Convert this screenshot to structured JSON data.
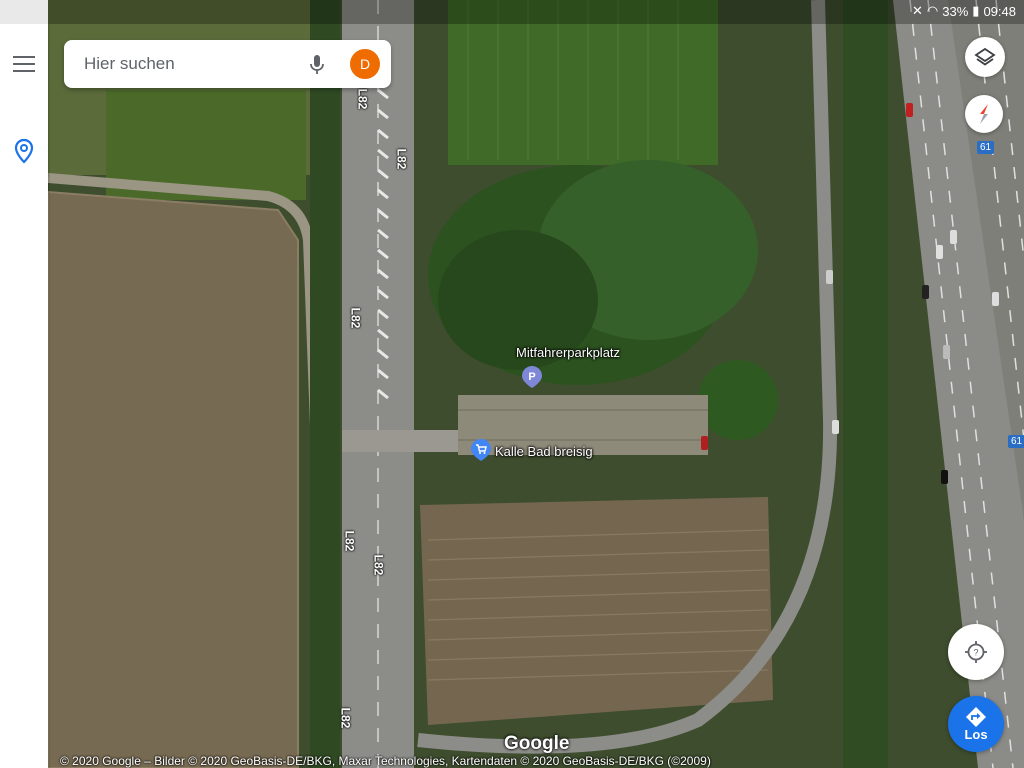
{
  "status_bar": {
    "battery": "33%",
    "time": "09:48"
  },
  "search": {
    "placeholder": "Hier suchen",
    "avatar_letter": "D"
  },
  "map": {
    "road_labels": [
      "L82",
      "L82",
      "L82",
      "L82",
      "L82",
      "L82"
    ],
    "route_badges": [
      "61",
      "61"
    ],
    "places": {
      "parking": "Mitfahrerparkplatz",
      "shop": "Kalle Bad breisig"
    },
    "logo": "Google",
    "copyright": "© 2020 Google – Bilder © 2020 GeoBasis-DE/BKG, Maxar Technologies, Kartendaten © 2020 GeoBasis-DE/BKG (©2009)"
  },
  "buttons": {
    "go_label": "Los"
  },
  "icons": {
    "menu": "menu-icon",
    "pin": "location-pin-icon",
    "mic": "mic-icon",
    "layers": "layers-icon",
    "compass": "compass-icon",
    "locate": "my-location-icon",
    "directions": "directions-icon",
    "parking": "parking-icon",
    "shopping": "shopping-cart-icon"
  },
  "colors": {
    "accent": "#1a73e8",
    "avatar": "#ef6c00"
  }
}
